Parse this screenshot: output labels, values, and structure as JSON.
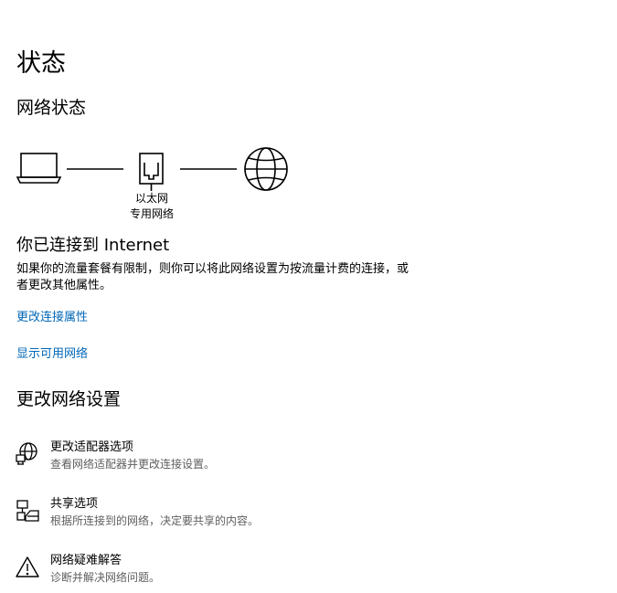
{
  "page": {
    "title": "状态",
    "network_status_heading": "网络状态"
  },
  "diagram": {
    "adapter_name": "以太网",
    "network_type": "专用网络"
  },
  "connection": {
    "headline": "你已连接到 Internet",
    "description": "如果你的流量套餐有限制，则你可以将此网络设置为按流量计费的连接，或者更改其他属性。",
    "change_properties_link": "更改连接属性",
    "show_networks_link": "显示可用网络"
  },
  "settings": {
    "heading": "更改网络设置",
    "options": [
      {
        "title": "更改适配器选项",
        "subtitle": "查看网络适配器并更改连接设置。",
        "icon": "adapter-globe-icon"
      },
      {
        "title": "共享选项",
        "subtitle": "根据所连接到的网络，决定要共享的内容。",
        "icon": "sharing-icon"
      },
      {
        "title": "网络疑难解答",
        "subtitle": "诊断并解决网络问题。",
        "icon": "warning-icon"
      }
    ]
  },
  "colors": {
    "link": "#0067b8",
    "subtext": "#5e5e5e"
  }
}
